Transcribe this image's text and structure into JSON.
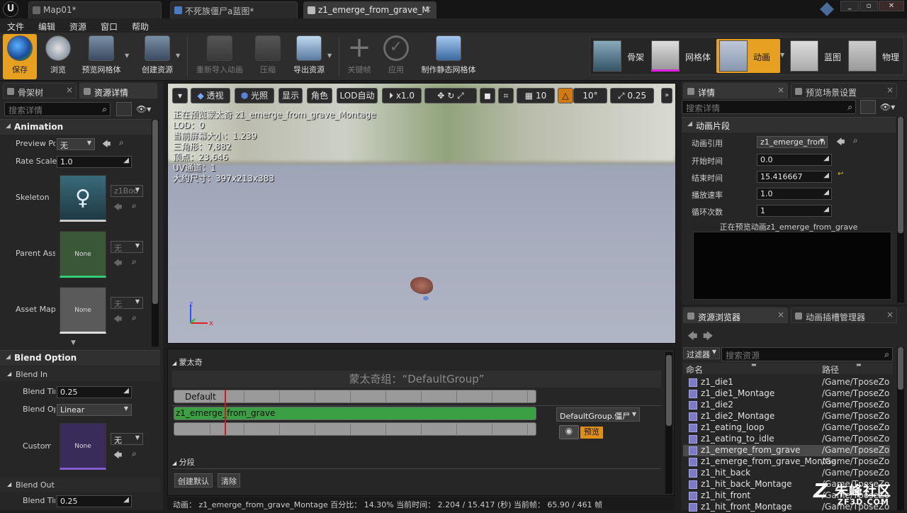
{
  "titlebar": {
    "tabs": [
      "Map01*",
      "不死族僵尸a蓝图*",
      "z1_emerge_from_grave_M"
    ]
  },
  "menu": [
    "文件",
    "编辑",
    "资源",
    "窗口",
    "帮助"
  ],
  "toolbar": {
    "buttons": [
      "保存",
      "浏览",
      "预览网格体",
      "创建资源",
      "重新导入动画",
      "压缩",
      "导出资源",
      "关键帧",
      "应用",
      "制作静态网格体"
    ]
  },
  "modes": [
    "骨架",
    "网格体",
    "动画",
    "蓝图",
    "物理"
  ],
  "left_panel": {
    "tabs": [
      "骨架树",
      "资源详情"
    ],
    "search_placeholder": "搜索详情",
    "animation_section": "Animation",
    "preview_pose_label": "Preview Po",
    "preview_pose_value": "无",
    "rate_scale_label": "Rate Scale",
    "rate_scale_value": "1.0",
    "skeleton_label": "Skeleton",
    "skeleton_value": "z1Bod",
    "parent_asset_label": "Parent Ass",
    "parent_asset_thumb": "None",
    "parent_asset_value": "无",
    "asset_map_label": "Asset Map",
    "asset_map_thumb": "None",
    "asset_map_value": "无",
    "blend_option_section": "Blend Option",
    "blend_in_section": "Blend In",
    "blend_time_label": "Blend Tir",
    "blend_time_value": "0.25",
    "blend_option_label": "Blend Op",
    "blend_option_value": "Linear",
    "custom_label": "Custom C",
    "custom_thumb": "None",
    "custom_value": "无",
    "blend_out_section": "Blend Out",
    "blend_out_time_label": "Blend Tir",
    "blend_out_time_value": "0.25"
  },
  "viewport": {
    "buttons": {
      "perspective": "透视",
      "lit": "光照",
      "show": "显示",
      "character": "角色",
      "lod": "LOD自动",
      "speed": "x1.0",
      "grid_value": "10",
      "angle_value": "10°",
      "scale_value": "0.25"
    },
    "info": [
      "正在预览蒙太奇 z1_emerge_from_grave_Montage",
      "LOD：0",
      "当前屏幕大小：1.239",
      "三角形：7,882",
      "顶点：23,646",
      "UV通道：1",
      "大约尺寸：397x213x383"
    ]
  },
  "montage": {
    "section_label": "蒙太奇",
    "group_title": "蒙太奇组：“DefaultGroup”",
    "default_slot": "Default",
    "anim_segment": "z1_emerge_from_grave",
    "slot_dropdown": "DefaultGroup.僵尸",
    "preview_button": "预览",
    "sections_label": "分段",
    "create_default_button": "创建默认",
    "clear_button": "清除"
  },
  "statusbar": {
    "text": "动画：  z1_emerge_from_grave_Montage                       百分比：  14.30%  当前时间：  2.204 / 15.417 (秒)  当前帧：  65.90 / 461 帧"
  },
  "details": {
    "tabs": [
      "详情",
      "预览场景设置"
    ],
    "search_placeholder": "搜索详情",
    "section": "动画片段",
    "anim_ref_label": "动画引用",
    "anim_ref_value": "z1_emerge_from",
    "start_time_label": "开始时间",
    "start_time_value": "0.0",
    "end_time_label": "结束时间",
    "end_time_value": "15.416667",
    "play_rate_label": "播放速率",
    "play_rate_value": "1.0",
    "loop_count_label": "循环次数",
    "loop_count_value": "1",
    "preview_caption": "正在预览动画z1_emerge_from_grave"
  },
  "content_browser": {
    "tabs": [
      "资源浏览器",
      "动画插槽管理器"
    ],
    "filter_label": "过滤器",
    "search_placeholder": "搜索资源",
    "col_name": "命名",
    "col_path": "路径",
    "rows": [
      {
        "name": "z1_die1",
        "path": "/Game/TposeZor"
      },
      {
        "name": "z1_die1_Montage",
        "path": "/Game/TposeZor"
      },
      {
        "name": "z1_die2",
        "path": "/Game/TposeZor"
      },
      {
        "name": "z1_die2_Montage",
        "path": "/Game/TposeZor"
      },
      {
        "name": "z1_eating_loop",
        "path": "/Game/TposeZor"
      },
      {
        "name": "z1_eating_to_idle",
        "path": "/Game/TposeZor"
      },
      {
        "name": "z1_emerge_from_grave",
        "path": "/Game/TposeZor"
      },
      {
        "name": "z1_emerge_from_grave_Montag",
        "path": "/Game/TposeZor"
      },
      {
        "name": "z1_hit_back",
        "path": "/Game/TposeZor"
      },
      {
        "name": "z1_hit_back_Montage",
        "path": "/Game/TposeZor"
      },
      {
        "name": "z1_hit_front",
        "path": "/Game/TposeZor"
      },
      {
        "name": "z1_hit_front_Montage",
        "path": "/Game/TposeZor"
      }
    ]
  },
  "watermark": {
    "line1": "朱峰社区",
    "line2": "ZF3D.COM"
  },
  "colors": {
    "accent_orange": "#d07a10",
    "segment_green": "#3aa043",
    "playhead_red": "#d01b1b"
  }
}
